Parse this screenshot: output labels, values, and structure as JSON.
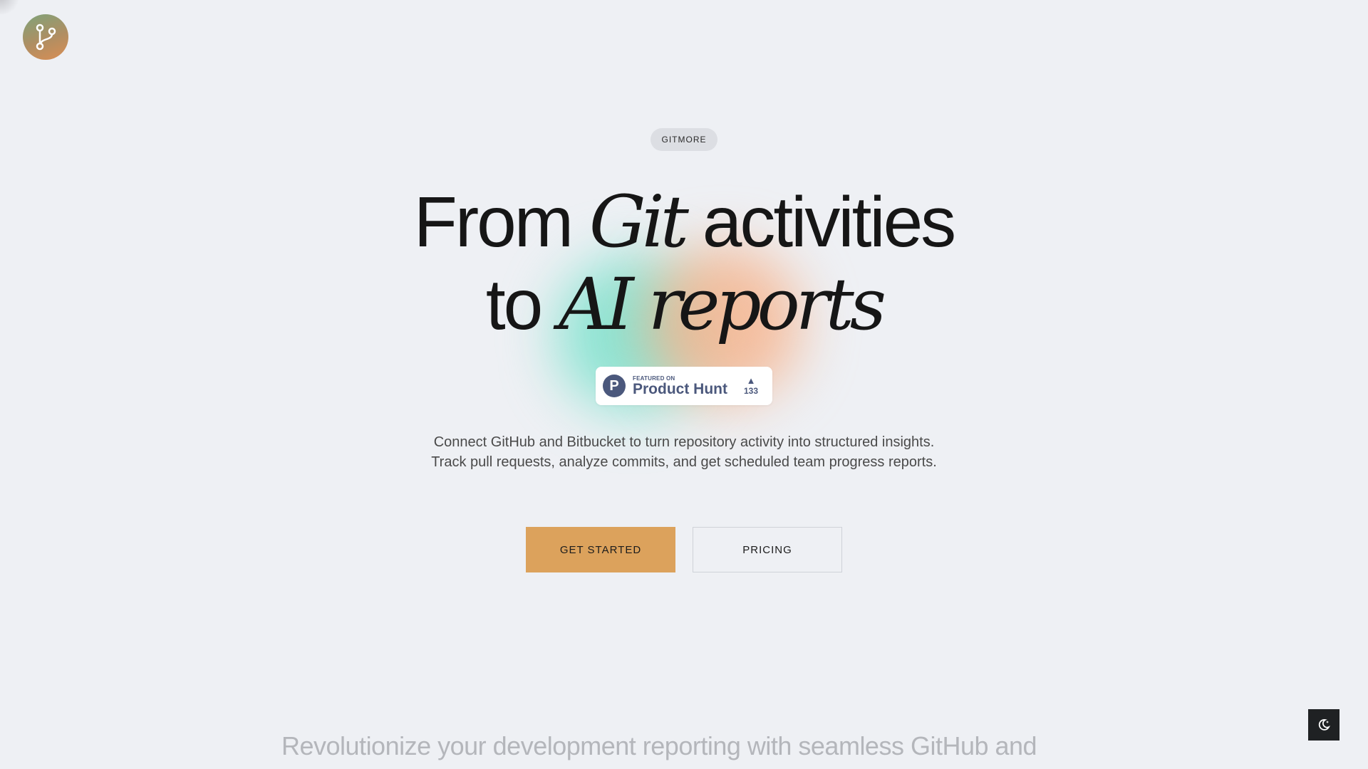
{
  "header": {
    "logo_icon": "git-branch-icon",
    "logo_gradient": [
      "#7fa37a",
      "#d98e54"
    ]
  },
  "hero": {
    "badge": "GITMORE",
    "headline": {
      "line1_a": "From ",
      "line1_italic": "Git",
      "line1_b": " activities",
      "line2_a": "to ",
      "line2_italic": "AI reports"
    },
    "product_hunt": {
      "featured_on": "FEATURED ON",
      "name": "Product Hunt",
      "logo_letter": "P",
      "vote_icon": "triangle-up-icon",
      "votes": "133",
      "color": "#4b587c"
    },
    "description_line1": "Connect GitHub and Bitbucket to turn repository activity into structured insights.",
    "description_line2": "Track pull requests, analyze commits, and get scheduled team progress reports.",
    "primary_button": "GET STARTED",
    "secondary_button": "PRICING"
  },
  "next_section": {
    "text": "Revolutionize your development reporting with seamless GitHub and Bitbucket integration"
  },
  "theme_toggle": {
    "icon": "moon-icon"
  },
  "colors": {
    "background": "#eef0f4",
    "accent": "#dca25c",
    "text": "#161616"
  }
}
